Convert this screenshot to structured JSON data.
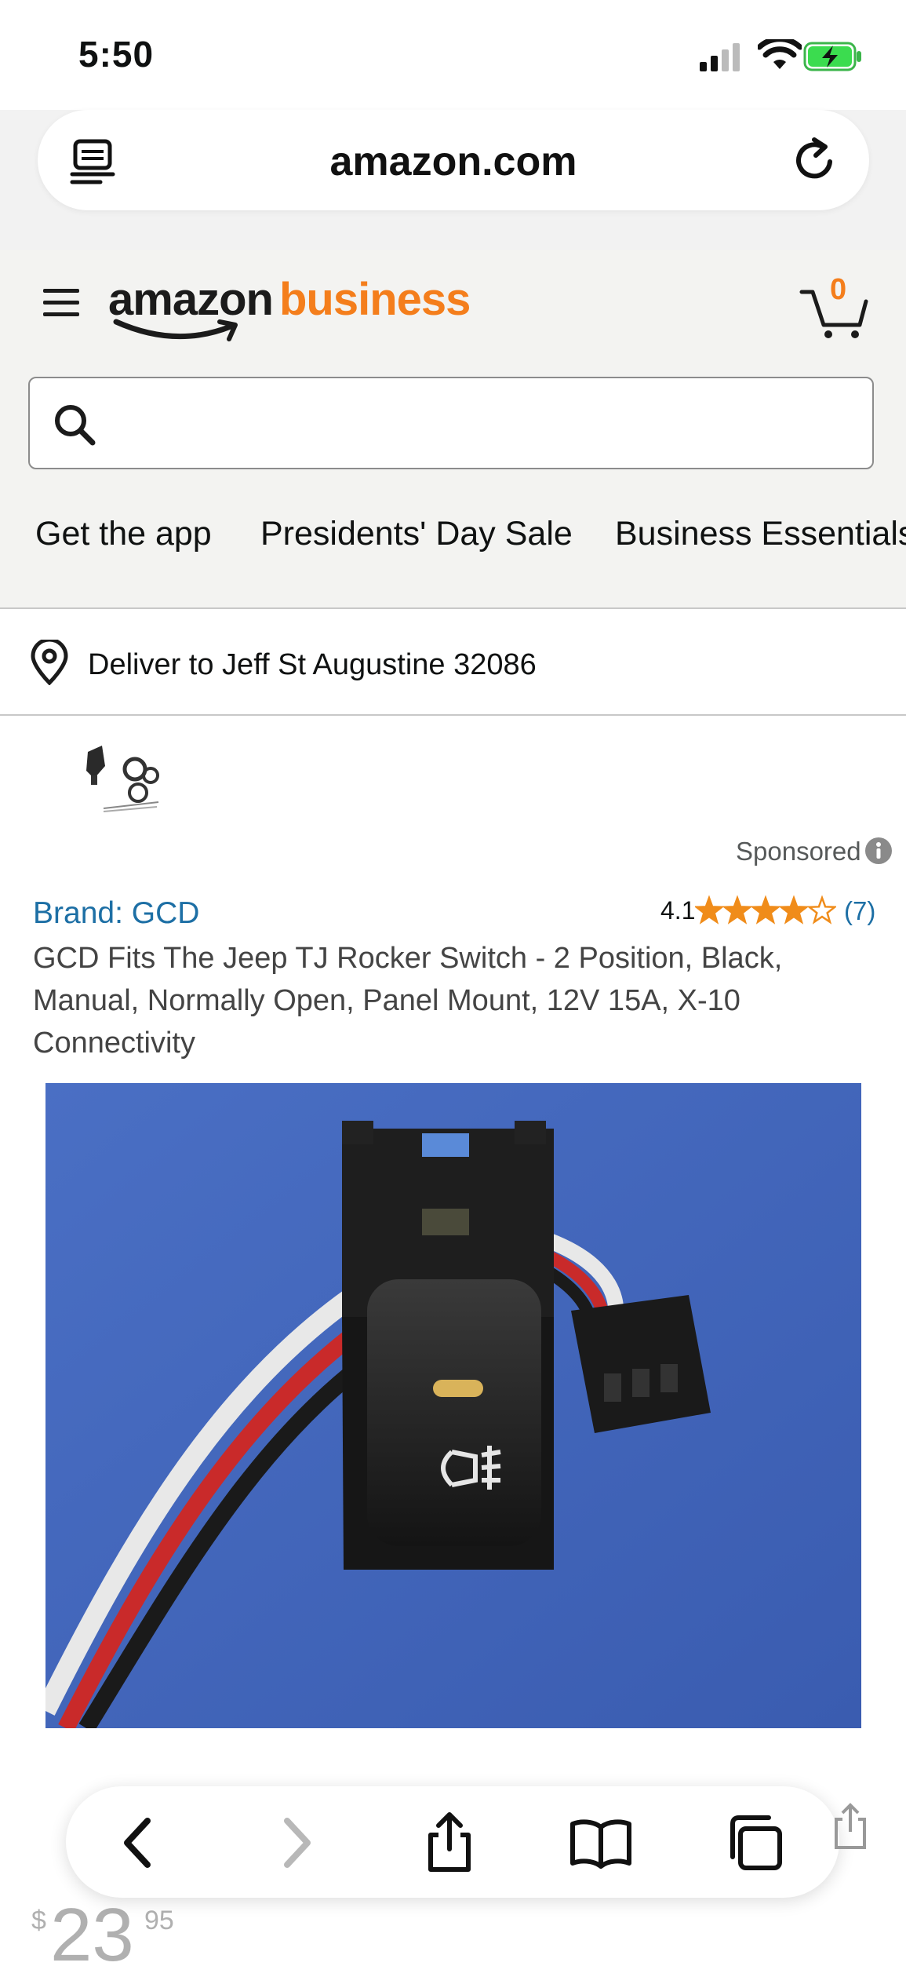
{
  "status_bar": {
    "time": "5:50"
  },
  "browser": {
    "url": "amazon.com"
  },
  "amazon": {
    "logo_amazon": "amazon",
    "logo_business": "business",
    "cart_count": "0",
    "search_placeholder": "",
    "nav_links": [
      "Get the app",
      "Presidents' Day Sale",
      "Business Essentials"
    ],
    "deliver_text": "Deliver to Jeff St Augustine 32086"
  },
  "product": {
    "sponsored_label": "Sponsored",
    "brand": "Brand: GCD",
    "rating": "4.1",
    "rating_value": 4.1,
    "rating_count": "(7)",
    "title": "GCD Fits The Jeep TJ Rocker Switch - 2 Position, Black, Manual, Normally Open, Panel Mount, 12V 15A, X-10 Connectivity",
    "price_symbol": "$",
    "price_whole": "23",
    "price_cents": "95"
  },
  "colors": {
    "brand_orange": "#f47e1c",
    "link_blue": "#1d6fa5",
    "star": "#f08c1a",
    "header_bg": "#f3f3f1"
  },
  "icons": [
    "reader-icon",
    "reload-icon",
    "hamburger-icon",
    "cart-icon",
    "search-icon",
    "location-pin-icon",
    "info-icon",
    "back-icon",
    "forward-icon",
    "share-icon",
    "bookmarks-icon",
    "tabs-icon"
  ]
}
